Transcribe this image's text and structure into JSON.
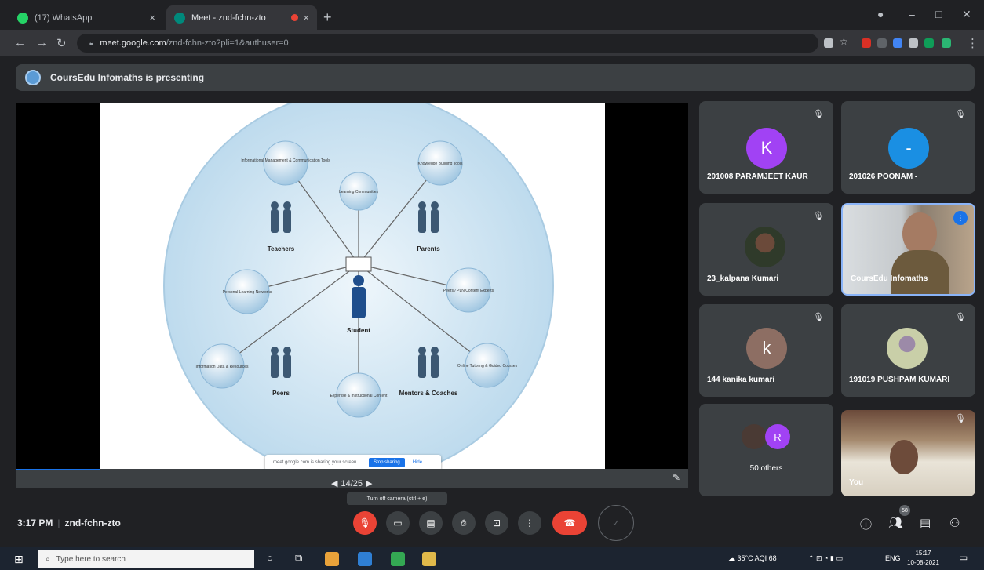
{
  "browser": {
    "tabs": [
      {
        "title": "(17) WhatsApp",
        "close": "×"
      },
      {
        "title": "Meet - znd-fchn-zto",
        "close": "×"
      }
    ],
    "new_tab": "+",
    "url_host": "meet.google.com",
    "url_path": "/znd-fchn-zto?pli=1&authuser=0",
    "win_controls": {
      "min": "–",
      "max": "□",
      "close": "✕"
    }
  },
  "banner": {
    "text": "CoursEdu Infomaths is presenting"
  },
  "slide": {
    "center_label": "Student",
    "nodes": [
      "Informational Management & Communication Tools",
      "Learning Communities",
      "Knowledge Building Tools",
      "Personal Learning Networks",
      "Peers / PLN Content Experts",
      "Information Data & Resources",
      "Expertise & Instructional Content",
      "Online Tutoring & Guided Courses"
    ],
    "groups": [
      "Teachers",
      "Parents",
      "Peers",
      "Mentors & Coaches"
    ]
  },
  "share_notice": {
    "text": "meet.google.com is sharing your screen.",
    "stop": "Stop sharing",
    "hide": "Hide"
  },
  "pager": {
    "label": "14/25"
  },
  "participants": [
    {
      "name": "201008 PARAMJEET KAUR",
      "initial": "K",
      "color": "#a142f4"
    },
    {
      "name": "201026 POONAM -",
      "initial": "-",
      "color": "#1a8fe3"
    },
    {
      "name": "23_kalpana Kumari"
    },
    {
      "name": "CoursEdu Infomaths"
    },
    {
      "name": "144 kanika kumari",
      "initial": "k",
      "color": "#8d6e63"
    },
    {
      "name": "191019 PUSHPAM KUMARI"
    },
    {
      "name": "50 others",
      "initial": "R",
      "color": "#a142f4"
    },
    {
      "name": "You"
    }
  ],
  "meeting": {
    "time": "3:17 PM",
    "code": "znd-fchn-zto",
    "tooltip": "Turn off camera (ctrl + e)",
    "people_count": "58"
  },
  "taskbar": {
    "search_placeholder": "Type here to search",
    "weather": "35°C AQI 68",
    "lang": "ENG",
    "clock_time": "15:17",
    "clock_date": "10-08-2021"
  }
}
